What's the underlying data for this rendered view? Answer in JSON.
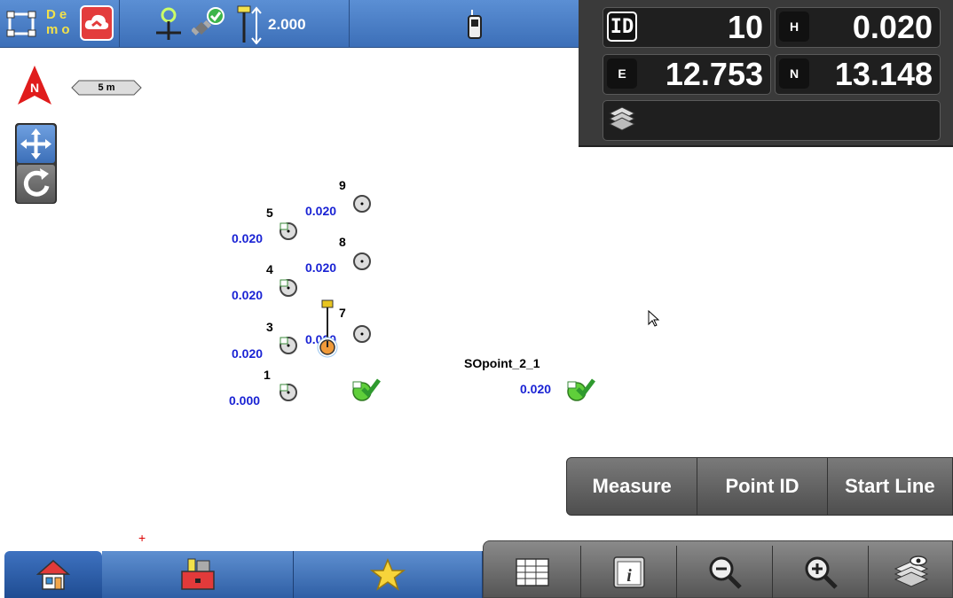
{
  "topbar": {
    "demo_label": "De mo",
    "instrument_height": "2.000"
  },
  "info_panel": {
    "id_tag": "ID",
    "id_value": "10",
    "h_tag": "H",
    "h_value": "0.020",
    "e_tag": "E",
    "e_value": "12.753",
    "n_tag": "N",
    "n_value": "13.148",
    "layer_value": ""
  },
  "map": {
    "scale_label": "5 m",
    "north_label": "N",
    "points": [
      {
        "id": "9",
        "value": "0.020"
      },
      {
        "id": "5",
        "value": "0.020"
      },
      {
        "id": "8",
        "value": "0.020"
      },
      {
        "id": "4",
        "value": "0.020"
      },
      {
        "id": "7",
        "value": "0.020"
      },
      {
        "id": "3",
        "value": "0.020"
      },
      {
        "id": "1",
        "value": "0.000"
      },
      {
        "id": "SOpoint_2_1",
        "value": "0.020"
      }
    ]
  },
  "actions": {
    "measure": "Measure",
    "point_id": "Point ID",
    "start_line": "Start Line"
  },
  "colors": {
    "accent_blue": "#3c6fb8",
    "value_blue": "#1a23d4",
    "panel_dark": "#3a3a3a",
    "staked_green": "#5fcf3a"
  },
  "icons": [
    "project-icon",
    "cloud-icon",
    "gnss-icon",
    "satellite-check-icon",
    "pole-height-icon",
    "radio-icon",
    "layers-icon",
    "north-arrow-icon",
    "pan-icon",
    "rotate-icon",
    "home-icon",
    "toolbox-icon",
    "star-icon",
    "table-icon",
    "info-icon",
    "zoom-out-icon",
    "zoom-in-icon",
    "layer-view-icon"
  ]
}
